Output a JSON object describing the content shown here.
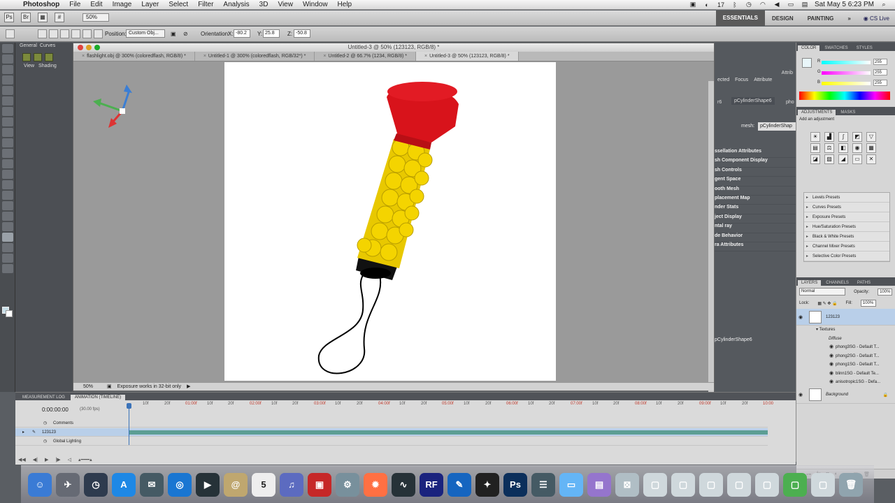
{
  "menubar": {
    "app_name": "Photoshop",
    "items": [
      "File",
      "Edit",
      "Image",
      "Layer",
      "Select",
      "Filter",
      "Analysis",
      "3D",
      "View",
      "Window",
      "Help"
    ],
    "clock": "Sat May 5  6:23 PM",
    "date_badge": "17"
  },
  "appbar": {
    "zoom": "50%",
    "workspaces": [
      "ESSENTIALS",
      "DESIGN",
      "PAINTING"
    ],
    "active_workspace": "ESSENTIALS",
    "cslive": "CS Live"
  },
  "options": {
    "position_label": "Position:",
    "position_value": "Custom Obj...",
    "orientation_label": "Orientation:",
    "x_label": "X:",
    "x_value": "-80.2",
    "y_label": "Y:",
    "y_value": "25.8",
    "z_label": "Z:",
    "z_value": "-50.8"
  },
  "left3d": {
    "tabs": [
      "General",
      "Curves"
    ],
    "sub": [
      "View",
      "Shading"
    ]
  },
  "document": {
    "window_title": "Untitled-3 @ 50% (123123, RGB/8) *",
    "tabs": [
      "flashlight.obj @ 300% (coloredflash, RGB/8) *",
      "Untitled-1 @ 300% (coloredflash, RGB/32*) *",
      "Untitled-2 @ 66.7% (1234, RGB/8) *",
      "Untitled-3 @ 50% (123123, RGB/8) *"
    ],
    "active_tab": 3,
    "status_zoom": "50%",
    "status_text": "Exposure works in 32-bit only"
  },
  "props3d": {
    "tabs": [
      "ected",
      "Focus",
      "Attribute"
    ],
    "top_label": "Attrib",
    "shape_tab": "pCylinderShape6",
    "shape_tab_prefix": "r6",
    "shape_tab_suffix": "pho",
    "mesh_label": "mesh:",
    "mesh_value": "pCylinderShap",
    "attributes": [
      "ssellation Attributes",
      "sh Component Display",
      "sh Controls",
      "gent Space",
      "ooth Mesh",
      "placement Map",
      "nder Stats",
      "ject Display",
      "ntal ray",
      "de Behavior",
      "ra Attributes"
    ],
    "footer_shape": "pCylinderShape6"
  },
  "color_panel": {
    "tabs": [
      "COLOR",
      "SWATCHES",
      "STYLES"
    ],
    "channels": [
      {
        "label": "R",
        "value": "255"
      },
      {
        "label": "G",
        "value": "255"
      },
      {
        "label": "B",
        "value": "255"
      }
    ]
  },
  "adjustments": {
    "tabs": [
      "ADJUSTMENTS",
      "MASKS"
    ],
    "hint": "Add an adjustment",
    "presets": [
      "Levels Presets",
      "Curves Presets",
      "Exposure Presets",
      "Hue/Saturation Presets",
      "Black & White Presets",
      "Channel Mixer Presets",
      "Selective Color Presets"
    ]
  },
  "layers": {
    "tabs": [
      "LAYERS",
      "CHANNELS",
      "PATHS"
    ],
    "blend_mode": "Normal",
    "opacity_label": "Opacity:",
    "opacity_value": "100%",
    "lock_label": "Lock:",
    "fill_label": "Fill:",
    "fill_value": "100%",
    "main_layer": "123123",
    "textures_label": "Textures",
    "diffuse_label": "Diffuse",
    "textures": [
      "phong3SG - Default T...",
      "phong2SG - Default T...",
      "phong1SG - Default T...",
      "blinn1SG - Default Te...",
      "anisotropic1SG - Defa..."
    ],
    "background_layer": "Background"
  },
  "timeline": {
    "tabs": [
      "MEASUREMENT LOG",
      "ANIMATION (TIMELINE)"
    ],
    "timecode": "0:00:00:00",
    "fps": "(30.00 fps)",
    "ruler": [
      {
        "t": "10f",
        "key": false
      },
      {
        "t": "20f",
        "key": false
      },
      {
        "t": "01:00f",
        "key": true
      },
      {
        "t": "10f",
        "key": false
      },
      {
        "t": "20f",
        "key": false
      },
      {
        "t": "02:00f",
        "key": true
      },
      {
        "t": "10f",
        "key": false
      },
      {
        "t": "20f",
        "key": false
      },
      {
        "t": "03:00f",
        "key": true
      },
      {
        "t": "10f",
        "key": false
      },
      {
        "t": "20f",
        "key": false
      },
      {
        "t": "04:00f",
        "key": true
      },
      {
        "t": "10f",
        "key": false
      },
      {
        "t": "20f",
        "key": false
      },
      {
        "t": "05:00f",
        "key": true
      },
      {
        "t": "10f",
        "key": false
      },
      {
        "t": "20f",
        "key": false
      },
      {
        "t": "06:00f",
        "key": true
      },
      {
        "t": "10f",
        "key": false
      },
      {
        "t": "20f",
        "key": false
      },
      {
        "t": "07:00f",
        "key": true
      },
      {
        "t": "10f",
        "key": false
      },
      {
        "t": "20f",
        "key": false
      },
      {
        "t": "08:00f",
        "key": true
      },
      {
        "t": "10f",
        "key": false
      },
      {
        "t": "20f",
        "key": false
      },
      {
        "t": "09:00f",
        "key": true
      },
      {
        "t": "10f",
        "key": false
      },
      {
        "t": "20f",
        "key": false
      },
      {
        "t": "10:00",
        "key": true
      }
    ],
    "tracks": [
      "Comments",
      "123123",
      "Global Lighting"
    ]
  },
  "dock": {
    "apps": [
      {
        "name": "finder",
        "color": "#3a7bd5",
        "glyph": "☺"
      },
      {
        "name": "launchpad",
        "color": "#666a74",
        "glyph": "✈"
      },
      {
        "name": "dashboard",
        "color": "#2e3b4e",
        "glyph": "◷"
      },
      {
        "name": "app-store",
        "color": "#1e88e5",
        "glyph": "A"
      },
      {
        "name": "photo-app",
        "color": "#455a64",
        "glyph": "✉"
      },
      {
        "name": "safari",
        "color": "#1976d2",
        "glyph": "◎"
      },
      {
        "name": "quicktime",
        "color": "#263238",
        "glyph": "▶"
      },
      {
        "name": "contacts",
        "color": "#bfa76f",
        "glyph": "@"
      },
      {
        "name": "ical",
        "color": "#eeeeee",
        "glyph": "5"
      },
      {
        "name": "itunes",
        "color": "#5c6bc0",
        "glyph": "♫"
      },
      {
        "name": "photobooth",
        "color": "#c62828",
        "glyph": "▣"
      },
      {
        "name": "preferences",
        "color": "#78909c",
        "glyph": "⚙"
      },
      {
        "name": "maya",
        "color": "#ff7043",
        "glyph": "✹"
      },
      {
        "name": "activity-monitor",
        "color": "#263238",
        "glyph": "∿"
      },
      {
        "name": "rf-app",
        "color": "#1a237e",
        "glyph": "RF"
      },
      {
        "name": "painter-app",
        "color": "#1565c0",
        "glyph": "✎"
      },
      {
        "name": "3d-app",
        "color": "#212121",
        "glyph": "✦"
      },
      {
        "name": "photoshop",
        "color": "#0b2f5b",
        "glyph": "Ps"
      },
      {
        "name": "bridge",
        "color": "#455a64",
        "glyph": "☰"
      },
      {
        "name": "folder",
        "color": "#64b5f6",
        "glyph": "▭"
      },
      {
        "name": "stack",
        "color": "#9575cd",
        "glyph": "▤"
      },
      {
        "name": "stack-2",
        "color": "#b0bec5",
        "glyph": "⊠"
      },
      {
        "name": "window-1",
        "color": "#cfd8dc",
        "glyph": "▢"
      },
      {
        "name": "window-2",
        "color": "#cfd8dc",
        "glyph": "▢"
      },
      {
        "name": "window-3",
        "color": "#cfd8dc",
        "glyph": "▢"
      },
      {
        "name": "window-4",
        "color": "#cfd8dc",
        "glyph": "▢"
      },
      {
        "name": "window-5",
        "color": "#cfd8dc",
        "glyph": "▢"
      },
      {
        "name": "window-6",
        "color": "#4caf50",
        "glyph": "▢"
      },
      {
        "name": "window-7",
        "color": "#cfd8dc",
        "glyph": "▢"
      },
      {
        "name": "trash",
        "color": "#90a4ae",
        "glyph": "🗑"
      }
    ]
  }
}
